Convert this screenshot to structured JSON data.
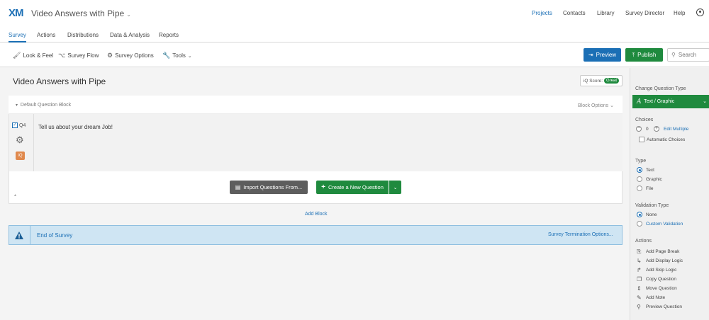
{
  "app": {
    "logo": "XM",
    "project_title": "Video Answers with Pipe",
    "top_nav": [
      "Projects",
      "Contacts",
      "Library",
      "Survey Director",
      "Help"
    ]
  },
  "tabs": [
    "Survey",
    "Actions",
    "Distributions",
    "Data & Analysis",
    "Reports"
  ],
  "toolbar": {
    "look_feel": "Look & Feel",
    "survey_flow": "Survey Flow",
    "survey_options": "Survey Options",
    "tools": "Tools",
    "preview": "Preview",
    "publish": "Publish",
    "search_placeholder": "Search"
  },
  "survey": {
    "title": "Video Answers with Pipe",
    "iq_score_label": "iQ Score:",
    "iq_score_value": "Great",
    "block_name": "Default Question Block",
    "block_options": "Block Options",
    "question": {
      "number": "Q4",
      "text": "Tell us about your dream Job!",
      "iq_badge": "iQ"
    },
    "import_button": "Import Questions From...",
    "create_button": "Create a New Question",
    "add_block": "Add Block",
    "end_of_survey": "End of Survey",
    "termination_options": "Survey Termination Options..."
  },
  "panel": {
    "change_type_label": "Change Question Type",
    "current_type": "Text / Graphic",
    "choices_label": "Choices",
    "choices_count": "0",
    "edit_multiple": "Edit Multiple",
    "automatic_choices": "Automatic Choices",
    "type_label": "Type",
    "types": [
      "Text",
      "Graphic",
      "File"
    ],
    "validation_label": "Validation Type",
    "validations": [
      "None",
      "Custom Validation"
    ],
    "actions_label": "Actions",
    "actions": [
      "Add Page Break",
      "Add Display Logic",
      "Add Skip Logic",
      "Copy Question",
      "Move Question",
      "Add Note",
      "Preview Question"
    ]
  },
  "colors": {
    "brand_blue": "#1b6fb5",
    "publish_green": "#1f8a3e",
    "end_survey_bg": "#cfe5f3"
  }
}
